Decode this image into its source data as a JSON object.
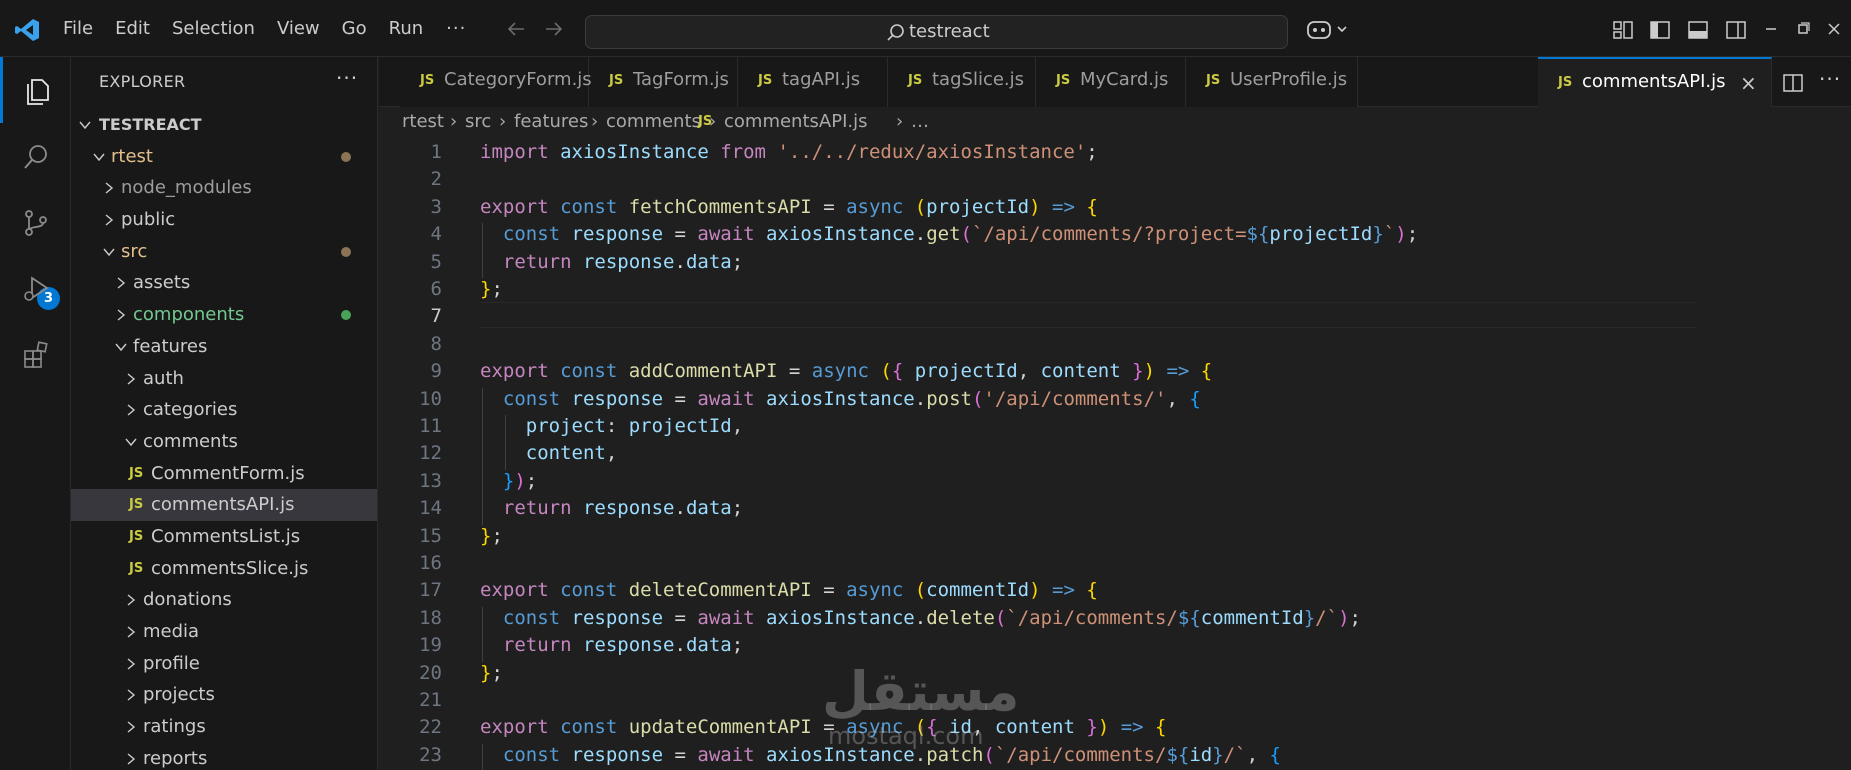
{
  "titlebar": {
    "menu": [
      "File",
      "Edit",
      "Selection",
      "View",
      "Go",
      "Run"
    ],
    "more": "···",
    "search_text": "testreact"
  },
  "activity": {
    "items": [
      "explorer-icon",
      "search-icon",
      "source-control-icon",
      "run-debug-icon",
      "extensions-icon"
    ],
    "scm_badge": "3"
  },
  "sidebar": {
    "title": "EXPLORER",
    "more": "···",
    "root": "TESTREACT",
    "tree": [
      {
        "label": "rtest",
        "depth": 1,
        "type": "folder",
        "open": true,
        "dot": true
      },
      {
        "label": "node_modules",
        "depth": 2,
        "type": "folder",
        "open": false
      },
      {
        "label": "public",
        "depth": 2,
        "type": "folder",
        "open": false
      },
      {
        "label": "src",
        "depth": 2,
        "type": "folder",
        "open": true,
        "dot": true
      },
      {
        "label": "assets",
        "depth": 3,
        "type": "folder",
        "open": false
      },
      {
        "label": "components",
        "depth": 3,
        "type": "folder",
        "open": false,
        "green": true
      },
      {
        "label": "features",
        "depth": 3,
        "type": "folder",
        "open": true
      },
      {
        "label": "auth",
        "depth": 4,
        "type": "folder",
        "open": false
      },
      {
        "label": "categories",
        "depth": 4,
        "type": "folder",
        "open": false
      },
      {
        "label": "comments",
        "depth": 4,
        "type": "folder",
        "open": true
      },
      {
        "label": "CommentForm.js",
        "depth": 5,
        "type": "file"
      },
      {
        "label": "commentsAPI.js",
        "depth": 5,
        "type": "file",
        "selected": true
      },
      {
        "label": "CommentsList.js",
        "depth": 5,
        "type": "file"
      },
      {
        "label": "commentsSlice.js",
        "depth": 5,
        "type": "file"
      },
      {
        "label": "donations",
        "depth": 4,
        "type": "folder",
        "open": false
      },
      {
        "label": "media",
        "depth": 4,
        "type": "folder",
        "open": false
      },
      {
        "label": "profile",
        "depth": 4,
        "type": "folder",
        "open": false
      },
      {
        "label": "projects",
        "depth": 4,
        "type": "folder",
        "open": false
      },
      {
        "label": "ratings",
        "depth": 4,
        "type": "folder",
        "open": false
      },
      {
        "label": "reports",
        "depth": 4,
        "type": "folder",
        "open": false
      }
    ]
  },
  "tabs": {
    "js_label": "JS",
    "items": [
      "CategoryForm.js",
      "TagForm.js",
      "tagAPI.js",
      "tagSlice.js",
      "MyCard.js",
      "UserProfile.js",
      "commentsAPI.js"
    ],
    "active_close": "×"
  },
  "breadcrumb": [
    "rtest",
    "src",
    "features",
    "comments",
    "commentsAPI.js",
    "…"
  ],
  "editor": {
    "current_line": 7,
    "lines": [
      [
        [
          "kc",
          "import "
        ],
        [
          "var",
          "axiosInstance "
        ],
        [
          "kc",
          "from "
        ],
        [
          "str",
          "'../../redux/axiosInstance'"
        ],
        [
          "op",
          ";"
        ]
      ],
      [],
      [
        [
          "kc",
          "export "
        ],
        [
          "kw",
          "const "
        ],
        [
          "fn",
          "fetchCommentsAPI "
        ],
        [
          "op",
          "= "
        ],
        [
          "kw",
          "async "
        ],
        [
          "p1",
          "("
        ],
        [
          "var",
          "projectId"
        ],
        [
          "p1",
          ")"
        ],
        [
          "kw",
          " => "
        ],
        [
          "p1",
          "{"
        ]
      ],
      [
        [
          "op",
          "  "
        ],
        [
          "kw",
          "const "
        ],
        [
          "var",
          "response "
        ],
        [
          "op",
          "= "
        ],
        [
          "kc",
          "await "
        ],
        [
          "var",
          "axiosInstance"
        ],
        [
          "op",
          "."
        ],
        [
          "fn",
          "get"
        ],
        [
          "p2",
          "("
        ],
        [
          "str",
          "`/api/comments/?project="
        ],
        [
          "kw",
          "${"
        ],
        [
          "var",
          "projectId"
        ],
        [
          "kw",
          "}"
        ],
        [
          "str",
          "`"
        ],
        [
          "p2",
          ")"
        ],
        [
          "op",
          ";"
        ]
      ],
      [
        [
          "op",
          "  "
        ],
        [
          "kc",
          "return "
        ],
        [
          "var",
          "response"
        ],
        [
          "op",
          "."
        ],
        [
          "var",
          "data"
        ],
        [
          "op",
          ";"
        ]
      ],
      [
        [
          "p1",
          "}"
        ],
        [
          "op",
          ";"
        ]
      ],
      [],
      [],
      [
        [
          "kc",
          "export "
        ],
        [
          "kw",
          "const "
        ],
        [
          "fn",
          "addCommentAPI "
        ],
        [
          "op",
          "= "
        ],
        [
          "kw",
          "async "
        ],
        [
          "p1",
          "("
        ],
        [
          "p2",
          "{ "
        ],
        [
          "var",
          "projectId"
        ],
        [
          "op",
          ", "
        ],
        [
          "var",
          "content "
        ],
        [
          "p2",
          "}"
        ],
        [
          "p1",
          ")"
        ],
        [
          "kw",
          " => "
        ],
        [
          "p1",
          "{"
        ]
      ],
      [
        [
          "op",
          "  "
        ],
        [
          "kw",
          "const "
        ],
        [
          "var",
          "response "
        ],
        [
          "op",
          "= "
        ],
        [
          "kc",
          "await "
        ],
        [
          "var",
          "axiosInstance"
        ],
        [
          "op",
          "."
        ],
        [
          "fn",
          "post"
        ],
        [
          "p2",
          "("
        ],
        [
          "str",
          "'/api/comments/'"
        ],
        [
          "op",
          ", "
        ],
        [
          "p3",
          "{"
        ]
      ],
      [
        [
          "op",
          "    "
        ],
        [
          "var",
          "project"
        ],
        [
          "op",
          ": "
        ],
        [
          "var",
          "projectId"
        ],
        [
          "op",
          ","
        ]
      ],
      [
        [
          "op",
          "    "
        ],
        [
          "var",
          "content"
        ],
        [
          "op",
          ","
        ]
      ],
      [
        [
          "op",
          "  "
        ],
        [
          "p3",
          "}"
        ],
        [
          "p2",
          ")"
        ],
        [
          "op",
          ";"
        ]
      ],
      [
        [
          "op",
          "  "
        ],
        [
          "kc",
          "return "
        ],
        [
          "var",
          "response"
        ],
        [
          "op",
          "."
        ],
        [
          "var",
          "data"
        ],
        [
          "op",
          ";"
        ]
      ],
      [
        [
          "p1",
          "}"
        ],
        [
          "op",
          ";"
        ]
      ],
      [],
      [
        [
          "kc",
          "export "
        ],
        [
          "kw",
          "const "
        ],
        [
          "fn",
          "deleteCommentAPI "
        ],
        [
          "op",
          "= "
        ],
        [
          "kw",
          "async "
        ],
        [
          "p1",
          "("
        ],
        [
          "var",
          "commentId"
        ],
        [
          "p1",
          ")"
        ],
        [
          "kw",
          " => "
        ],
        [
          "p1",
          "{"
        ]
      ],
      [
        [
          "op",
          "  "
        ],
        [
          "kw",
          "const "
        ],
        [
          "var",
          "response "
        ],
        [
          "op",
          "= "
        ],
        [
          "kc",
          "await "
        ],
        [
          "var",
          "axiosInstance"
        ],
        [
          "op",
          "."
        ],
        [
          "fn",
          "delete"
        ],
        [
          "p2",
          "("
        ],
        [
          "str",
          "`/api/comments/"
        ],
        [
          "kw",
          "${"
        ],
        [
          "var",
          "commentId"
        ],
        [
          "kw",
          "}"
        ],
        [
          "str",
          "/`"
        ],
        [
          "p2",
          ")"
        ],
        [
          "op",
          ";"
        ]
      ],
      [
        [
          "op",
          "  "
        ],
        [
          "kc",
          "return "
        ],
        [
          "var",
          "response"
        ],
        [
          "op",
          "."
        ],
        [
          "var",
          "data"
        ],
        [
          "op",
          ";"
        ]
      ],
      [
        [
          "p1",
          "}"
        ],
        [
          "op",
          ";"
        ]
      ],
      [],
      [
        [
          "kc",
          "export "
        ],
        [
          "kw",
          "const "
        ],
        [
          "fn",
          "updateCommentAPI "
        ],
        [
          "op",
          "= "
        ],
        [
          "kw",
          "async "
        ],
        [
          "p1",
          "("
        ],
        [
          "p2",
          "{ "
        ],
        [
          "var",
          "id"
        ],
        [
          "op",
          ", "
        ],
        [
          "var",
          "content "
        ],
        [
          "p2",
          "}"
        ],
        [
          "p1",
          ")"
        ],
        [
          "kw",
          " => "
        ],
        [
          "p1",
          "{"
        ]
      ],
      [
        [
          "op",
          "  "
        ],
        [
          "kw",
          "const "
        ],
        [
          "var",
          "response "
        ],
        [
          "op",
          "= "
        ],
        [
          "kc",
          "await "
        ],
        [
          "var",
          "axiosInstance"
        ],
        [
          "op",
          "."
        ],
        [
          "fn",
          "patch"
        ],
        [
          "p2",
          "("
        ],
        [
          "str",
          "`/api/comments/"
        ],
        [
          "kw",
          "${"
        ],
        [
          "var",
          "id"
        ],
        [
          "kw",
          "}"
        ],
        [
          "str",
          "/`"
        ],
        [
          "op",
          ", "
        ],
        [
          "p3",
          "{"
        ]
      ]
    ]
  },
  "watermark": {
    "text": "مستقل",
    "sub": "mostaql.com"
  },
  "colors": {
    "accent": "#0078d4",
    "folder_dot": "#8b7355",
    "green_dot": "#4aa35a"
  }
}
